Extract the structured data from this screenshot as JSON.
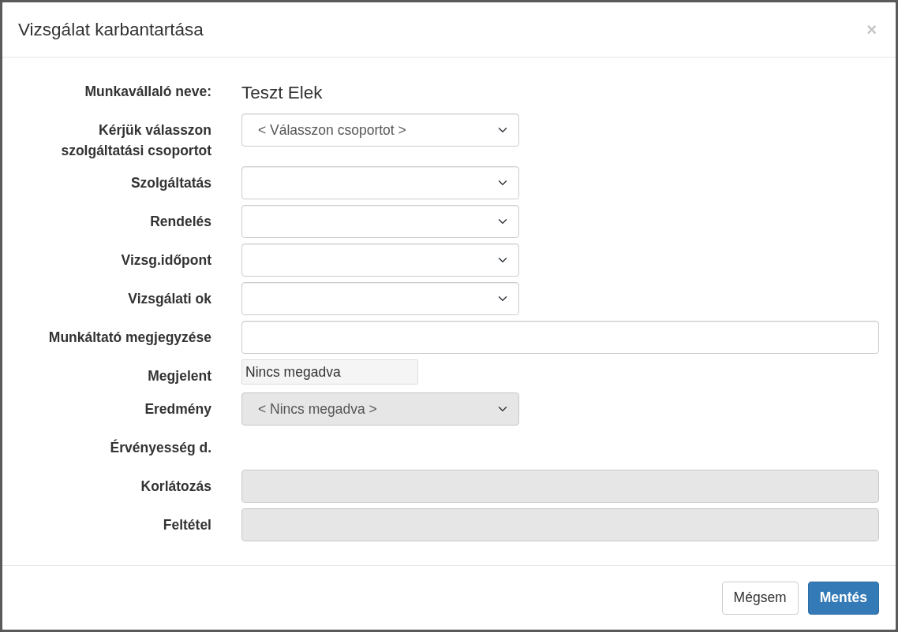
{
  "dialog": {
    "title": "Vizsgálat karbantartása",
    "close": "×"
  },
  "fields": [
    {
      "kind": "text",
      "label": "Munkavállaló neve:",
      "value": "Teszt Elek"
    },
    {
      "kind": "select",
      "label": "Kérjük válasszon szolgáltatási csoportot",
      "value": "< Válasszon csoportot >",
      "disabled": false
    },
    {
      "kind": "select",
      "label": "Szolgáltatás",
      "disabled": false
    },
    {
      "kind": "select",
      "label": "Rendelés",
      "disabled": false
    },
    {
      "kind": "select",
      "label": "Vizsg.időpont",
      "disabled": false
    },
    {
      "kind": "select",
      "label": "Vizsgálati ok",
      "disabled": false
    },
    {
      "kind": "input",
      "label": "Munkáltató megjegyzése",
      "disabled": false
    },
    {
      "kind": "readonly",
      "label": "Megjelent",
      "value": "Nincs megadva"
    },
    {
      "kind": "select",
      "label": "Eredmény",
      "value": "< Nincs megadva >",
      "disabled": true
    },
    {
      "kind": "none",
      "label": "Érvényesség d."
    },
    {
      "kind": "input",
      "label": "Korlátozás",
      "disabled": true
    },
    {
      "kind": "input",
      "label": "Feltétel",
      "disabled": true
    }
  ],
  "buttons": [
    {
      "label": "Mégsem",
      "primary": false
    },
    {
      "label": "Mentés",
      "primary": true
    }
  ]
}
